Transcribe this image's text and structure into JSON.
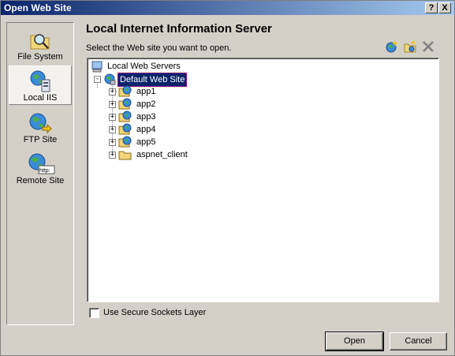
{
  "window": {
    "title": "Open Web Site"
  },
  "title_buttons": {
    "help": "?",
    "close": "X"
  },
  "sidebar": {
    "items": [
      {
        "label": "File System",
        "icon": "folder-magnifier-icon",
        "selected": false
      },
      {
        "label": "Local IIS",
        "icon": "local-iis-icon",
        "selected": true
      },
      {
        "label": "FTP Site",
        "icon": "ftp-globe-icon",
        "selected": false
      },
      {
        "label": "Remote Site",
        "icon": "remote-http-icon",
        "selected": false
      }
    ]
  },
  "main": {
    "heading": "Local Internet Information Server",
    "prompt": "Select the Web site you want to open.",
    "toolbar": [
      "new-web-application-icon",
      "new-virtual-directory-icon",
      "delete-icon"
    ]
  },
  "tree": {
    "root": "Local Web Servers",
    "site": "Default Web Site",
    "children": [
      {
        "label": "app1",
        "icon": "web-application-icon"
      },
      {
        "label": "app2",
        "icon": "web-application-icon"
      },
      {
        "label": "app3",
        "icon": "web-application-icon"
      },
      {
        "label": "app4",
        "icon": "web-application-icon"
      },
      {
        "label": "app5",
        "icon": "web-application-icon"
      },
      {
        "label": "aspnet_client",
        "icon": "folder-icon"
      }
    ]
  },
  "options": {
    "ssl_label": "Use Secure Sockets Layer",
    "ssl_checked": false
  },
  "buttons": {
    "open": "Open",
    "cancel": "Cancel"
  },
  "colors": {
    "title_start": "#0a246a",
    "title_end": "#a6caf0",
    "selection": "#0a246a",
    "face": "#d4d0c8"
  }
}
